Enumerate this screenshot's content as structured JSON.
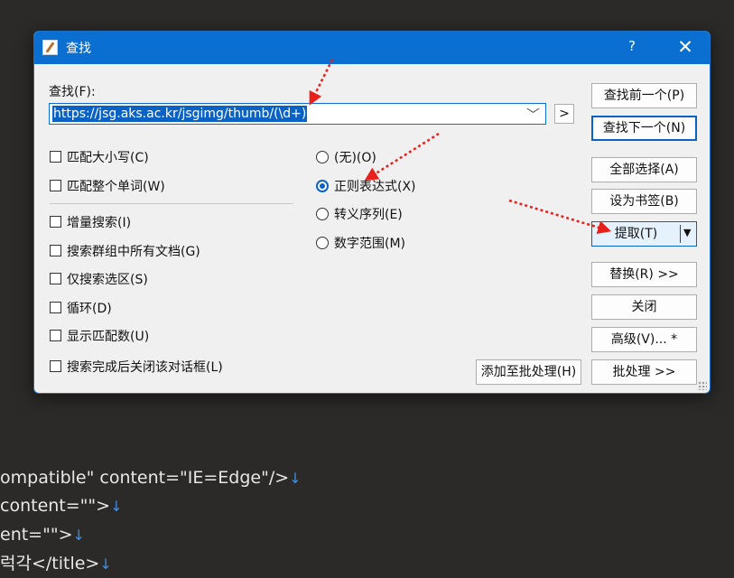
{
  "editor_lines": [
    "ompatible\" content=\"IE=Edge\"/>",
    "content=\"\">",
    "ent=\"\">",
    "럭각</title>"
  ],
  "newline_mark": "↓",
  "dialog": {
    "title": "查找",
    "help_label": "?",
    "close_label": "✕",
    "find_label": "查找(F):",
    "find_value": "https://jsg.aks.ac.kr/jsgimg/thumb/(\\d+)",
    "combo_arrow": "﹀",
    "history_button": ">",
    "checkboxes": [
      {
        "label": "匹配大小写(C)",
        "checked": false
      },
      {
        "label": "匹配整个单词(W)",
        "checked": false
      },
      {
        "label": "增量搜索(I)",
        "checked": false
      },
      {
        "label": "搜索群组中所有文档(G)",
        "checked": false
      },
      {
        "label": "仅搜索选区(S)",
        "checked": false
      },
      {
        "label": "循环(D)",
        "checked": false
      },
      {
        "label": "显示匹配数(U)",
        "checked": false
      },
      {
        "label": "搜索完成后关闭该对话框(L)",
        "checked": false
      }
    ],
    "radios": [
      {
        "label": "(无)(O)",
        "selected": false
      },
      {
        "label": "正则表达式(X)",
        "selected": true
      },
      {
        "label": "转义序列(E)",
        "selected": false
      },
      {
        "label": "数字范围(M)",
        "selected": false
      }
    ],
    "buttons": {
      "find_prev": "查找前一个(P)",
      "find_next": "查找下一个(N)",
      "select_all": "全部选择(A)",
      "bookmark": "设为书签(B)",
      "extract": "提取(T)",
      "extract_arrow": "▼",
      "replace": "替换(R) >>",
      "close": "关闭",
      "advanced": "高级(V)... *",
      "add_batch": "添加至批处理(H)",
      "batch": "批处理 >>"
    }
  },
  "colors": {
    "titlebar": "#0a6fd0",
    "annotation_arrow": "#e8201a",
    "selection": "#0a62c4"
  }
}
